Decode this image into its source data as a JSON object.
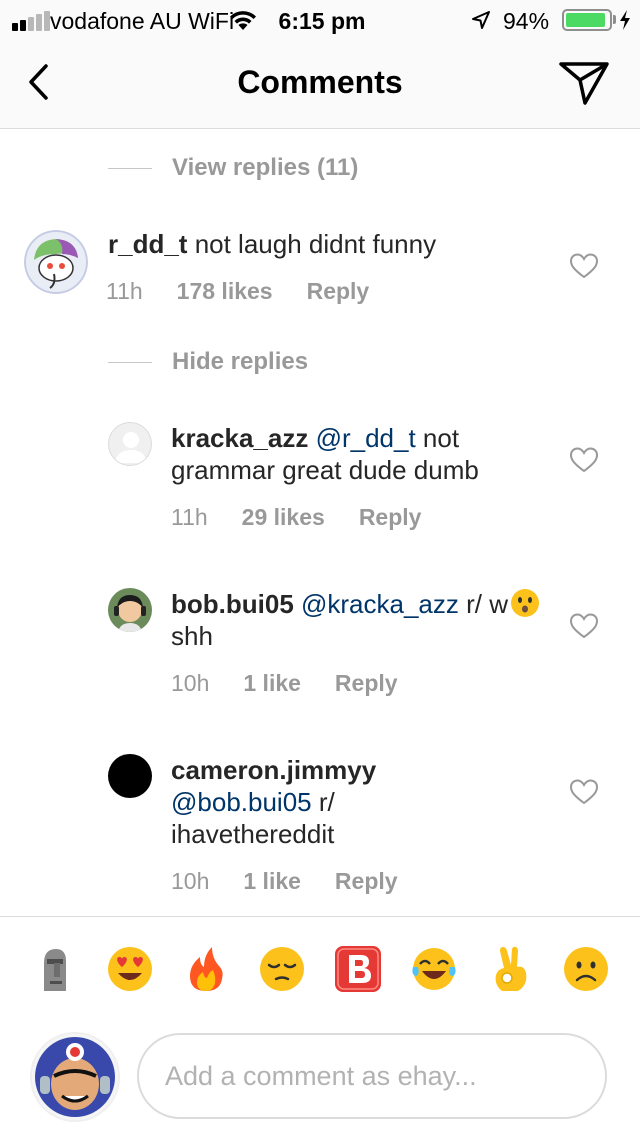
{
  "status_bar": {
    "carrier": "vodafone AU WiFi",
    "time": "6:15 pm",
    "battery": "94%"
  },
  "nav": {
    "title": "Comments",
    "back_icon": "chevron-left-icon",
    "send_icon": "paper-plane-icon"
  },
  "threads": [
    {
      "toggle_label": "View replies (11)"
    },
    {
      "toggle_label": "Hide replies"
    }
  ],
  "comments": [
    {
      "username": "r_dd_t",
      "text": " not laugh didnt funny",
      "time": "11h",
      "likes": "178 likes",
      "reply": "Reply"
    },
    {
      "username": "kracka_azz",
      "mention": " @r_dd_t",
      "text": " not grammar great dude dumb",
      "time": "11h",
      "likes": "29 likes",
      "reply": "Reply"
    },
    {
      "username": "bob.bui05",
      "mention": " @kracka_azz",
      "text_before_emoji": " r/ w",
      "text_after_emoji": "shh",
      "time": "10h",
      "likes": "1 like",
      "reply": "Reply"
    },
    {
      "username": "cameron.jimmyy",
      "mention": "@bob.bui05",
      "text": " r/ ihavethereddit",
      "time": "10h",
      "likes": "1 like",
      "reply": "Reply"
    }
  ],
  "emoji_bar": [
    "moai-emoji",
    "heart-eyes-emoji",
    "fire-emoji",
    "pensive-emoji",
    "b-button-emoji",
    "tears-of-joy-emoji",
    "ok-hand-emoji",
    "frowning-emoji"
  ],
  "compose": {
    "placeholder": "Add a comment as ehay..."
  },
  "colors": {
    "mention": "#003569",
    "meta_gray": "#999999",
    "battery_green": "#4cd964"
  }
}
